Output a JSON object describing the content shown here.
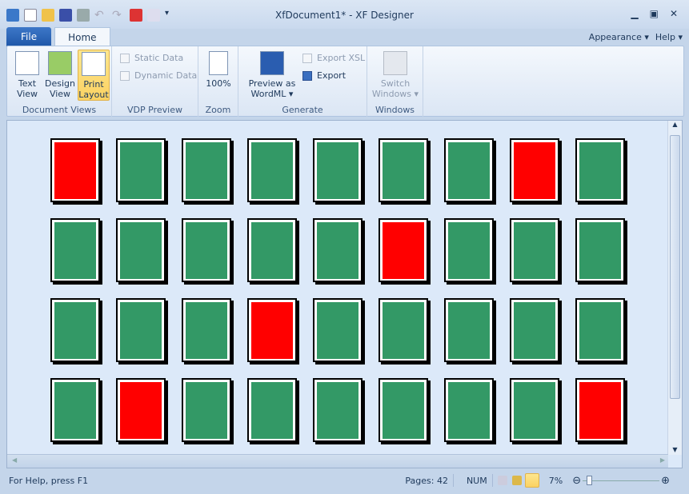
{
  "window": {
    "title": "XfDocument1* -  XF Designer"
  },
  "quick_access": [
    "app-icon",
    "new-icon",
    "open-icon",
    "save-icon",
    "print-icon",
    "undo-icon",
    "redo-icon",
    "pdf-icon",
    "preview-icon",
    "customize-icon"
  ],
  "tabs": {
    "file": "File",
    "home": "Home"
  },
  "right_menu": {
    "appearance": "Appearance",
    "help": "Help"
  },
  "ribbon": {
    "document_views": {
      "label": "Document Views",
      "text_view": "Text View",
      "design_view": "Design View",
      "print_layout": "Print Layout"
    },
    "vdp_preview": {
      "label": "VDP Preview",
      "static_data": "Static Data",
      "dynamic_data": "Dynamic Data"
    },
    "zoom": {
      "label": "Zoom",
      "zoom_100": "100%"
    },
    "generate": {
      "label": "Generate",
      "preview_wordml": "Preview as WordML",
      "export_xsl": "Export XSL",
      "export": "Export"
    },
    "windows": {
      "label": "Windows",
      "switch_windows": "Switch Windows"
    }
  },
  "pages": {
    "columns": 9,
    "colors": {
      "ok": "#339966",
      "error": "#ff0000"
    },
    "rows": [
      [
        "error",
        "ok",
        "ok",
        "ok",
        "ok",
        "ok",
        "ok",
        "error",
        "ok"
      ],
      [
        "ok",
        "ok",
        "ok",
        "ok",
        "ok",
        "error",
        "ok",
        "ok",
        "ok"
      ],
      [
        "ok",
        "ok",
        "ok",
        "error",
        "ok",
        "ok",
        "ok",
        "ok",
        "ok"
      ],
      [
        "ok",
        "error",
        "ok",
        "ok",
        "ok",
        "ok",
        "ok",
        "ok",
        "error"
      ]
    ]
  },
  "status": {
    "help": "For Help, press F1",
    "pages": "Pages: 42",
    "num": "NUM",
    "zoom": "7%",
    "zoom_level_percent": 7
  }
}
